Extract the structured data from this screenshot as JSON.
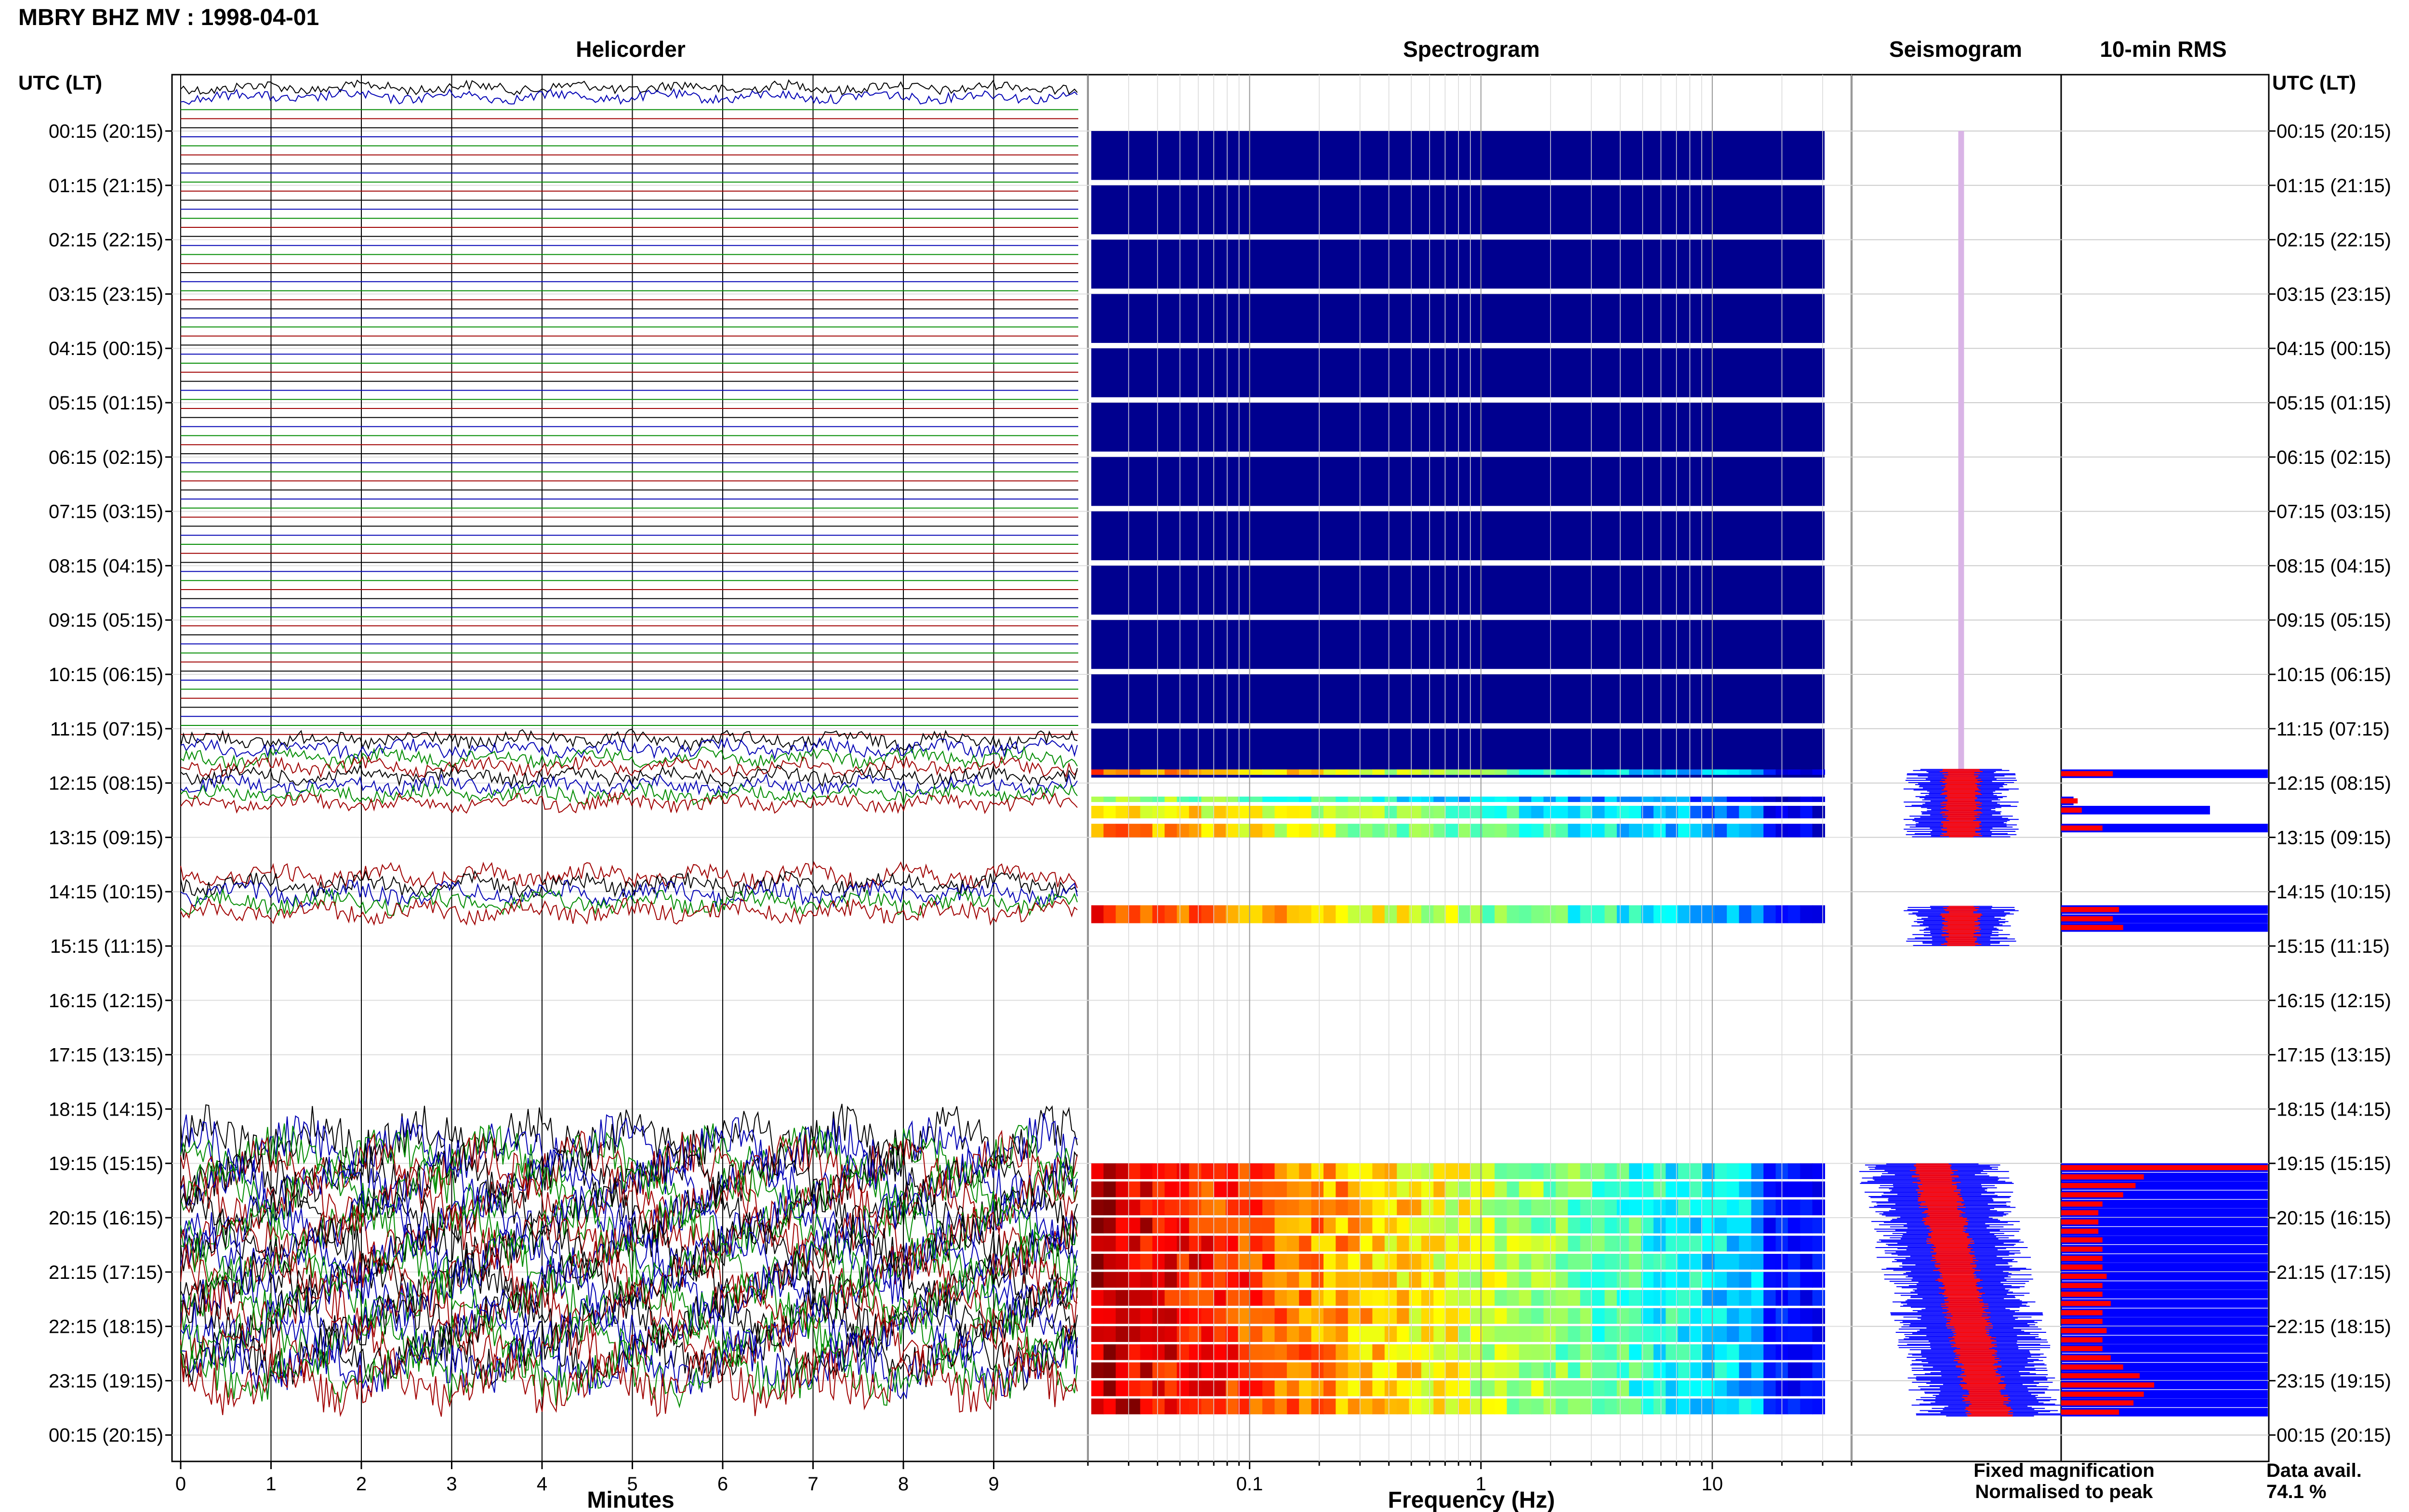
{
  "chart_data": {
    "type": "seismic_summary",
    "title": "MBRY BHZ MV : 1998-04-01",
    "panel_titles": [
      "Helicorder",
      "Spectrogram",
      "Seismogram",
      "10-min RMS"
    ],
    "time_axis_label": "UTC (LT)",
    "time_ticks": [
      "00:15 (20:15)",
      "01:15 (21:15)",
      "02:15 (22:15)",
      "03:15 (23:15)",
      "04:15 (00:15)",
      "05:15 (01:15)",
      "06:15 (02:15)",
      "07:15 (03:15)",
      "08:15 (04:15)",
      "09:15 (05:15)",
      "10:15 (06:15)",
      "11:15 (07:15)",
      "12:15 (08:15)",
      "13:15 (09:15)",
      "14:15 (10:15)",
      "15:15 (11:15)",
      "16:15 (12:15)",
      "17:15 (13:15)",
      "18:15 (14:15)",
      "19:15 (15:15)",
      "20:15 (16:15)",
      "21:15 (17:15)",
      "22:15 (18:15)",
      "23:15 (19:15)",
      "00:15 (20:15)"
    ],
    "helicorder": {
      "xlabel": "Minutes",
      "x_ticks": [
        "0",
        "1",
        "2",
        "3",
        "4",
        "5",
        "6",
        "7",
        "8",
        "9"
      ],
      "xlim": [
        0,
        10
      ],
      "trace_colors": [
        "#000000",
        "#0000b4",
        "#008c00",
        "#a00000"
      ]
    },
    "spectrogram": {
      "xlabel": "Frequency (Hz)",
      "scale": "log",
      "x_ticks": [
        "0.1",
        "1",
        "10"
      ],
      "xlim": [
        0.02,
        40
      ]
    },
    "data_gaps_utc": [
      [
        0.25,
        12.0
      ],
      [
        13.25,
        14.5
      ],
      [
        15.25,
        19.25
      ],
      [
        23.9,
        24.25
      ]
    ],
    "seismogram": {
      "fixed_color": "#0000ff",
      "normalised_color": "#ff0000"
    },
    "rms": {
      "intervals_start_utc": [
        12.0,
        12.5,
        12.67,
        13.0,
        14.5,
        14.67,
        14.83,
        19.25,
        19.42,
        19.58,
        19.75,
        19.92,
        20.08,
        20.25,
        20.42,
        20.58,
        20.75,
        20.92,
        21.08,
        21.25,
        21.42,
        21.58,
        21.75,
        21.92,
        22.08,
        22.25,
        22.42,
        22.58,
        22.75,
        22.92,
        23.08,
        23.25,
        23.42,
        23.58,
        23.75
      ],
      "fixed_relative": [
        1.0,
        0.06,
        0.72,
        1.0,
        1.0,
        1.0,
        1.0,
        1.0,
        1.0,
        1.0,
        1.0,
        1.0,
        1.0,
        1.0,
        1.0,
        1.0,
        1.0,
        1.0,
        1.0,
        1.0,
        1.0,
        1.0,
        1.0,
        1.0,
        1.0,
        1.0,
        1.0,
        1.0,
        1.0,
        1.0,
        1.0,
        1.0,
        1.0,
        1.0,
        1.0
      ],
      "normalised_relative": [
        0.25,
        0.08,
        0.1,
        0.2,
        0.28,
        0.25,
        0.3,
        1.0,
        0.4,
        0.36,
        0.3,
        0.2,
        0.18,
        0.18,
        0.18,
        0.2,
        0.2,
        0.2,
        0.2,
        0.22,
        0.2,
        0.2,
        0.24,
        0.2,
        0.2,
        0.22,
        0.2,
        0.2,
        0.24,
        0.3,
        0.38,
        0.45,
        0.4,
        0.35,
        0.28
      ]
    },
    "legend": [
      "Fixed magnification",
      "Normalised to peak"
    ],
    "legend_colors": [
      "#0000ff",
      "#ff0000"
    ],
    "data_availability": {
      "label": "Data avail.",
      "value": "74.1 %"
    }
  }
}
